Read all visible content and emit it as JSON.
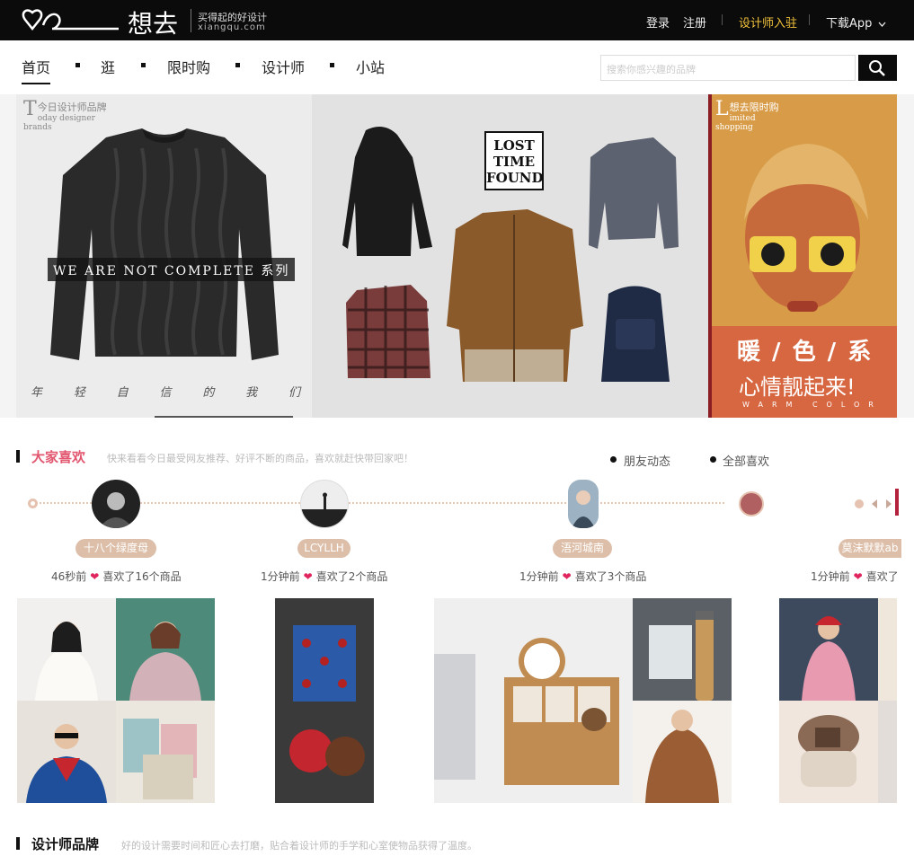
{
  "header": {
    "logo_cn": "想去",
    "slogan": "买得起的好设计",
    "domain": "xiangqu.com",
    "login": "登录",
    "register": "注册",
    "designer_join": "设计师入驻",
    "download_app": "下载App"
  },
  "nav": {
    "items": [
      "首页",
      "逛",
      "限时购",
      "设计师",
      "小站"
    ],
    "search_placeholder": "搜索你感兴趣的品牌"
  },
  "banner": {
    "left": {
      "tag_letter": "T",
      "tag_cn": "今日设计师品牌",
      "tag_en": "oday designer brands",
      "slogan": "WE ARE NOT COMPLETE 系列",
      "motto": [
        "年",
        "轻",
        "自",
        "信",
        "的",
        "我",
        "们"
      ]
    },
    "center": {
      "logo_text": "LOST TIME FOUND"
    },
    "right": {
      "tag_letter": "L",
      "tag_cn": "想去限时购",
      "tag_en": "imited shopping",
      "line1": "暖 / 色 / 系",
      "line2": "心情靓起来!",
      "line3": "WARM COLOR"
    }
  },
  "likes": {
    "title": "大家喜欢",
    "desc": "快来看看今日最受网友推荐、好评不断的商品，喜欢就赶快带回家吧！",
    "filters": [
      "朋友动态",
      "全部喜欢"
    ],
    "users": [
      {
        "name": "十八个绿度母",
        "time": "46秒前",
        "liked": "喜欢了16个商品"
      },
      {
        "name": "LCYLLH",
        "time": "1分钟前",
        "liked": "喜欢了2个商品"
      },
      {
        "name": "浯河城南",
        "time": "1分钟前",
        "liked": "喜欢了3个商品"
      },
      {
        "name": "莫沫默默ab",
        "time": "1分钟前",
        "liked": "喜欢了"
      }
    ]
  },
  "brands": {
    "title": "设计师品牌",
    "desc": "好的设计需要时间和匠心去打磨，贴合着设计师的手学和心室使物品获得了温度。"
  }
}
